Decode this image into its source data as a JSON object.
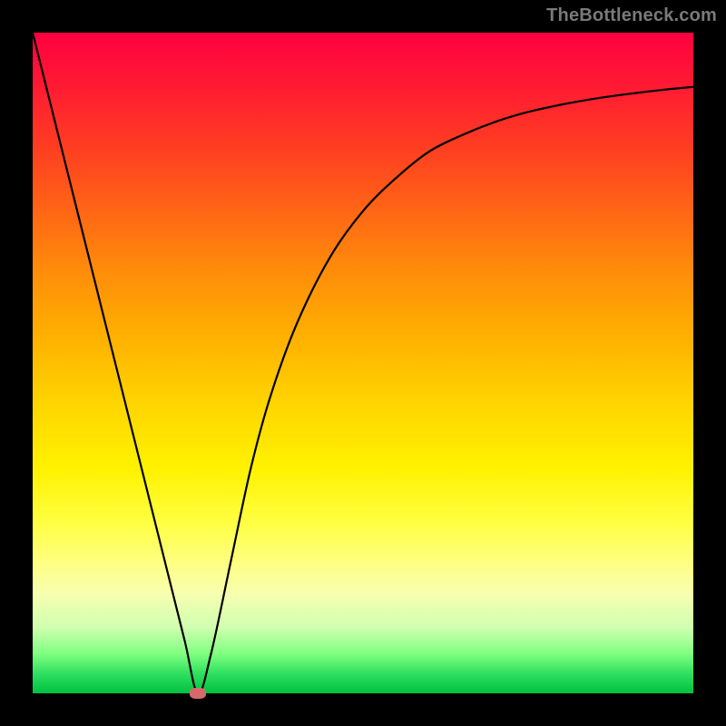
{
  "watermark": "TheBottleneck.com",
  "chart_data": {
    "type": "line",
    "title": "",
    "xlabel": "",
    "ylabel": "",
    "xlim": [
      0,
      100
    ],
    "ylim": [
      0,
      100
    ],
    "grid": false,
    "legend": false,
    "background_gradient": {
      "top": "#ff0040",
      "middle": "#ffd400",
      "bottom": "#00c040"
    },
    "series": [
      {
        "name": "bottleneck-curve",
        "color": "#000000",
        "x": [
          0,
          5,
          10,
          15,
          20,
          23,
          25,
          27,
          30,
          33,
          36,
          40,
          45,
          50,
          55,
          60,
          65,
          70,
          75,
          80,
          85,
          90,
          95,
          100
        ],
        "values": [
          100,
          80,
          60,
          40,
          20,
          8,
          0,
          6,
          20,
          34,
          45,
          56,
          66,
          73,
          78,
          82,
          84.5,
          86.5,
          88,
          89.1,
          90,
          90.7,
          91.3,
          91.8
        ]
      }
    ],
    "marker": {
      "x": 25,
      "y": 0,
      "color": "#d66a6a"
    }
  }
}
